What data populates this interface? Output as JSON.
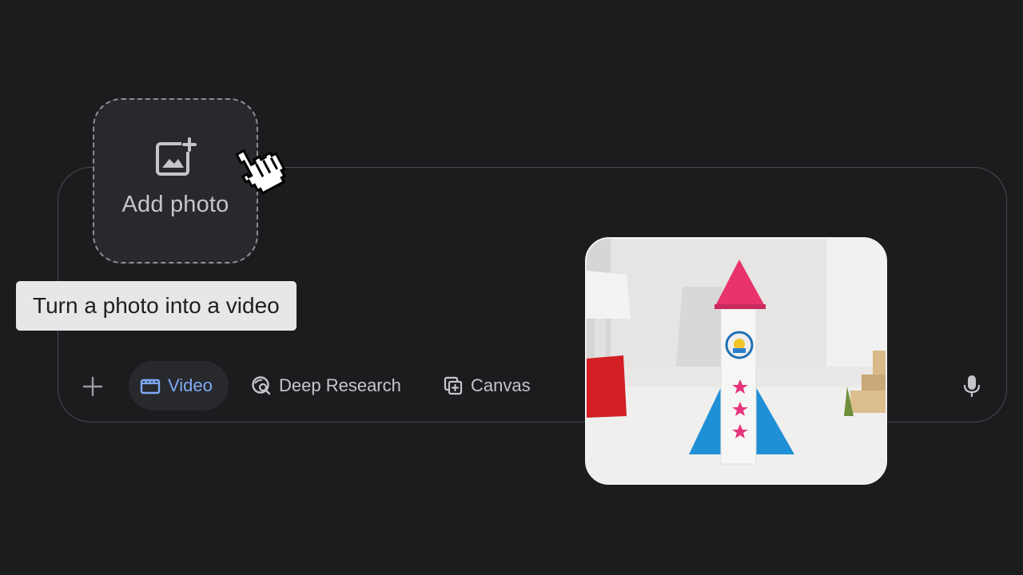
{
  "upload_tile": {
    "label": "Add photo",
    "icon": "add-photo-icon"
  },
  "tooltip": {
    "text": "Turn a photo into a video"
  },
  "toolbar": {
    "add_icon": "plus-icon",
    "tools": [
      {
        "label": "Video",
        "icon": "clapperboard-icon",
        "active": true
      },
      {
        "label": "Deep Research",
        "icon": "deep-research-icon",
        "active": false
      },
      {
        "label": "Canvas",
        "icon": "canvas-icon",
        "active": false
      }
    ],
    "mic_icon": "microphone-icon"
  },
  "preview": {
    "subject": "toy rocket photo"
  },
  "colors": {
    "background": "#1b1c1e",
    "active_tool": "#7fa9f5",
    "text": "#c4c6cb",
    "tooltip_bg": "#e7e7e9"
  }
}
